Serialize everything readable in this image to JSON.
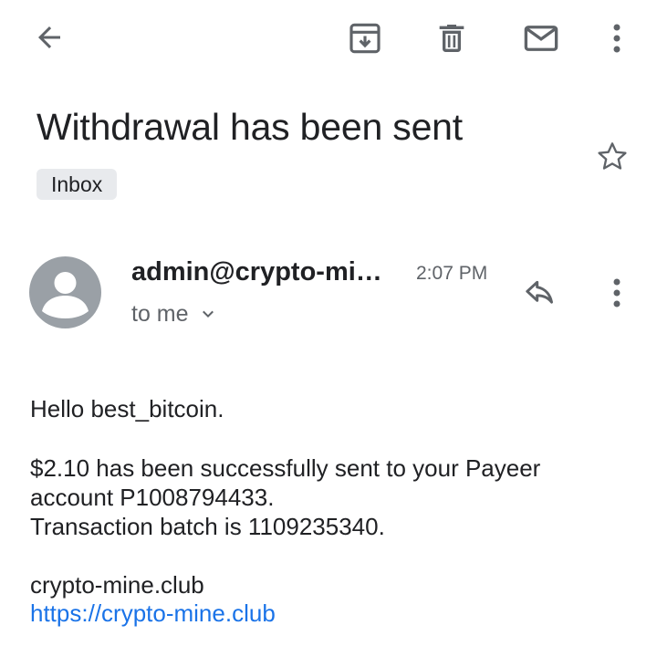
{
  "toolbar": {
    "back_icon": "arrow-left-icon",
    "archive_icon": "archive-icon",
    "delete_icon": "trash-icon",
    "mark_unread_icon": "mail-icon",
    "more_icon": "more-vert-icon"
  },
  "email": {
    "subject": "Withdrawal has been sent",
    "label": "Inbox",
    "star_icon": "star-outline-icon",
    "sender": "admin@crypto-mi…",
    "time": "2:07 PM",
    "recipient": "to me",
    "avatar_icon": "person-icon",
    "reply_icon": "reply-icon",
    "more_icon": "more-vert-icon",
    "body": {
      "greeting": "Hello best_bitcoin.",
      "line1": "$2.10 has been successfully sent to your Payeer",
      "line2": "account P1008794433.",
      "line3": "Transaction batch is 1109235340.",
      "signature": "crypto-mine.club",
      "link": "https://crypto-mine.club"
    }
  },
  "colors": {
    "text": "#202124",
    "secondary": "#5f6368",
    "chip_bg": "#e8eaed",
    "avatar_bg": "#9aa0a6",
    "link": "#1a73e8"
  }
}
